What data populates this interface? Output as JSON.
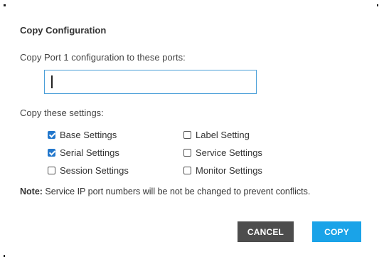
{
  "dialog": {
    "title": "Copy Configuration",
    "prompt": "Copy Port 1 configuration to these ports:",
    "ports_input_value": "",
    "settings_label": "Copy these settings:",
    "settings": [
      {
        "label": "Base Settings",
        "checked": true
      },
      {
        "label": "Label Setting",
        "checked": false
      },
      {
        "label": "Serial Settings",
        "checked": true
      },
      {
        "label": "Service Settings",
        "checked": false
      },
      {
        "label": "Session Settings",
        "checked": false
      },
      {
        "label": "Monitor Settings",
        "checked": false
      }
    ],
    "note_prefix": "Note:",
    "note_text": " Service IP port numbers will be not be changed to prevent conflicts.",
    "buttons": {
      "cancel": "CANCEL",
      "copy": "COPY"
    },
    "colors": {
      "copy_button": "#1aa3e8",
      "cancel_button": "#4d4d4d",
      "input_border": "#4a9fd8",
      "checkbox_checked": "#2277cc"
    }
  }
}
